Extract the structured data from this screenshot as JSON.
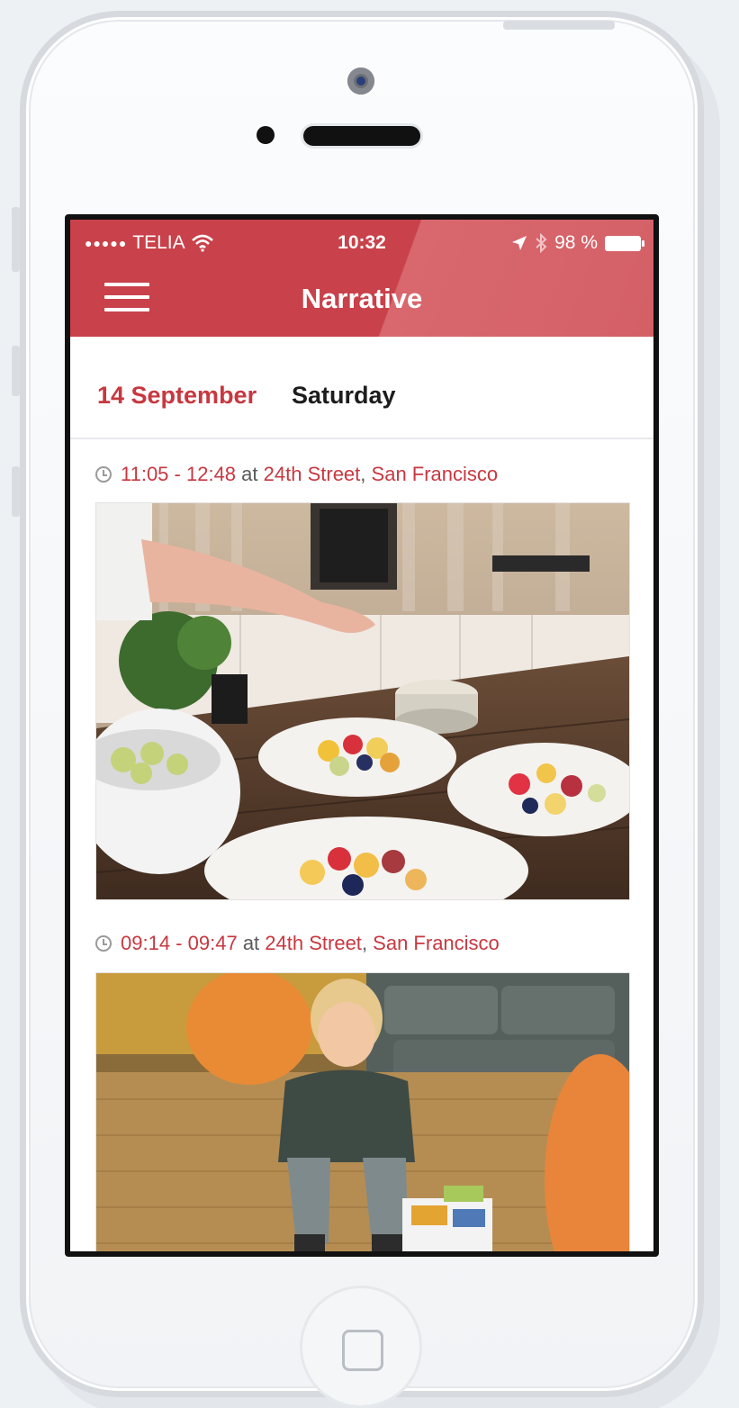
{
  "status_bar": {
    "carrier": "TELIA",
    "time": "10:32",
    "battery": "98 %"
  },
  "navbar": {
    "title": "Narrative"
  },
  "date_header": {
    "date": "14 September",
    "weekday": "Saturday"
  },
  "entries": [
    {
      "start": "11:05",
      "end": "12:48",
      "at": "at",
      "street": "24th Street",
      "city": "San Francisco"
    },
    {
      "start": "09:14",
      "end": "09:47",
      "at": "at",
      "street": "24th Street",
      "city": "San Francisco"
    }
  ],
  "colors": {
    "accent": "#c9414a",
    "accent_text": "#c73840"
  },
  "icons": [
    "signal-dots-icon",
    "wifi-icon",
    "location-arrow-icon",
    "bluetooth-icon",
    "battery-icon",
    "menu-icon",
    "clock-icon"
  ]
}
